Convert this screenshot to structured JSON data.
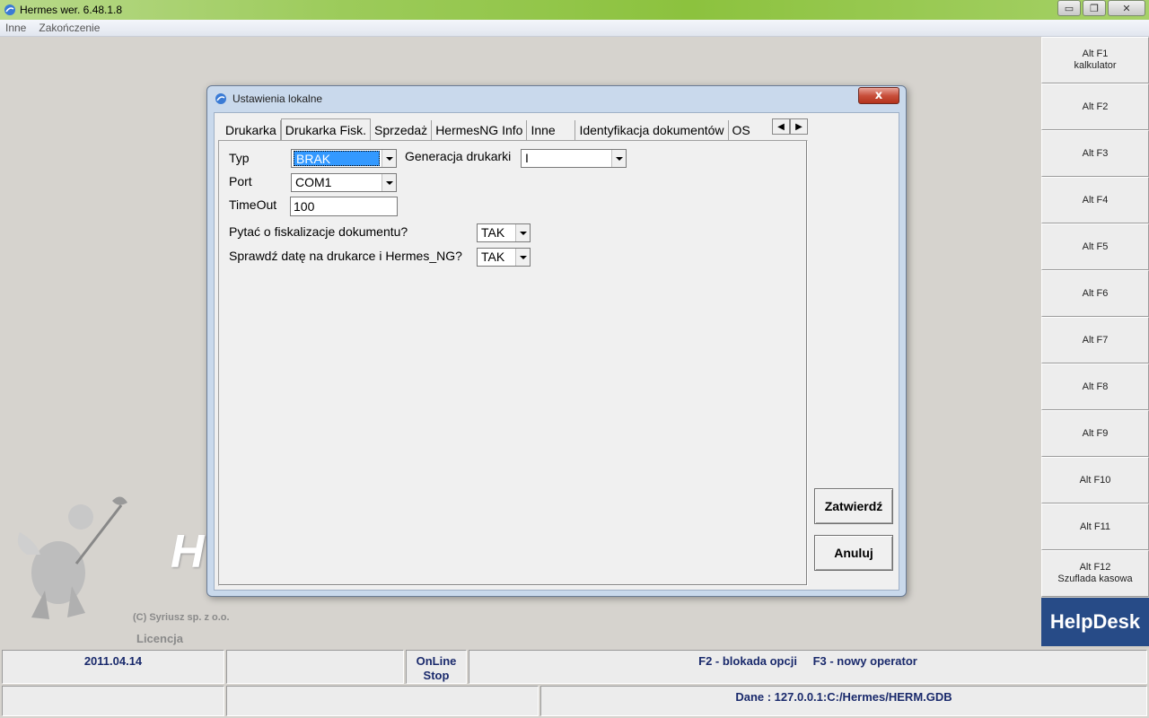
{
  "window": {
    "title": "Hermes wer. 6.48.1.8",
    "buttons": {
      "minimize": "▭",
      "restore": "❐",
      "close": "✕"
    }
  },
  "menu": {
    "items": [
      "Inne",
      "Zakończenie"
    ]
  },
  "background": {
    "logo_text": "H",
    "copyright": "(C) Syriusz sp. z o.o.",
    "licencja": "Licencja"
  },
  "fkeys": [
    {
      "key": "Alt F1",
      "label": "kalkulator"
    },
    {
      "key": "Alt F2",
      "label": ""
    },
    {
      "key": "Alt F3",
      "label": ""
    },
    {
      "key": "Alt F4",
      "label": ""
    },
    {
      "key": "Alt F5",
      "label": ""
    },
    {
      "key": "Alt F6",
      "label": ""
    },
    {
      "key": "Alt F7",
      "label": ""
    },
    {
      "key": "Alt F8",
      "label": ""
    },
    {
      "key": "Alt F9",
      "label": ""
    },
    {
      "key": "Alt F10",
      "label": ""
    },
    {
      "key": "Alt F11",
      "label": ""
    },
    {
      "key": "Alt F12",
      "label": "Szuflada kasowa"
    }
  ],
  "helpdesk": "HelpDesk",
  "status": {
    "date": "2011.04.14",
    "online": "OnLine",
    "stop": "Stop",
    "f2": "F2 - blokada opcji",
    "f3": "F3 - nowy operator",
    "dane": "Dane  : 127.0.0.1:C:/Hermes/HERM.GDB"
  },
  "dialog": {
    "title": "Ustawienia lokalne",
    "close": "x",
    "tabs": [
      "Drukarka",
      "Drukarka Fisk.",
      "Sprzedaż",
      "HermesNG Info",
      "Inne",
      "Identyfikacja dokumentów",
      "OS"
    ],
    "active_tab": "Drukarka Fisk.",
    "fields": {
      "typ_label": "Typ",
      "typ_value": "BRAK",
      "generacja_label": "Generacja drukarki",
      "generacja_value": "I",
      "port_label": "Port",
      "port_value": "COM1",
      "timeout_label": "TimeOut",
      "timeout_value": "100",
      "pytac_label": "Pytać o fiskalizacje dokumentu?",
      "pytac_value": "TAK",
      "sprawdz_label": "Sprawdź datę na drukarce i Hermes_NG?",
      "sprawdz_value": "TAK"
    },
    "buttons": {
      "ok": "Zatwierdź",
      "cancel": "Anuluj"
    }
  }
}
